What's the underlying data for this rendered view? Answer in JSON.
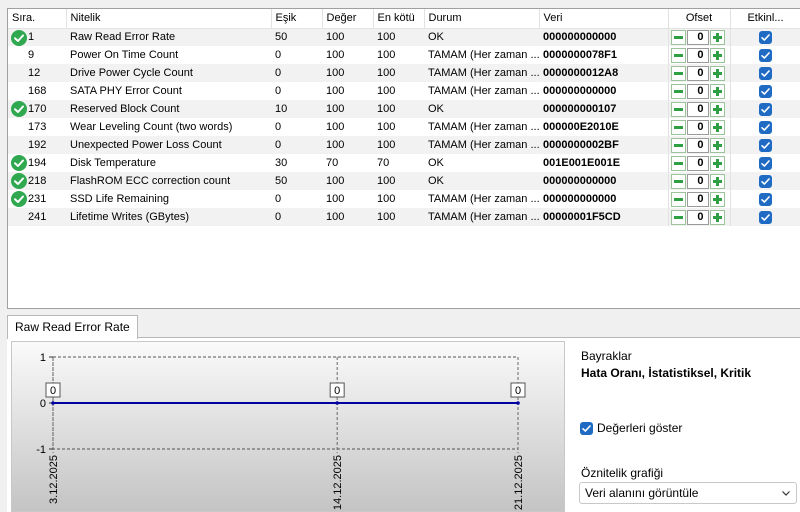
{
  "columns": {
    "idx": "Sıra.",
    "name": "Nitelik",
    "threshold": "Eşik",
    "value": "Değer",
    "worst": "En kötü",
    "status": "Durum",
    "data": "Veri",
    "offset": "Ofset",
    "enabled": "Etkinl..."
  },
  "rows": [
    {
      "idx": "1",
      "name": "Raw Read Error Rate",
      "threshold": "50",
      "value": "100",
      "worst": "100",
      "status": "OK",
      "data": "000000000000",
      "offset": "0",
      "enabled": true,
      "ok_icon": true
    },
    {
      "idx": "9",
      "name": "Power On Time Count",
      "threshold": "0",
      "value": "100",
      "worst": "100",
      "status": "TAMAM (Her zaman ...",
      "data": "0000000078F1",
      "offset": "0",
      "enabled": true,
      "ok_icon": false
    },
    {
      "idx": "12",
      "name": "Drive Power Cycle Count",
      "threshold": "0",
      "value": "100",
      "worst": "100",
      "status": "TAMAM (Her zaman ...",
      "data": "0000000012A8",
      "offset": "0",
      "enabled": true,
      "ok_icon": false
    },
    {
      "idx": "168",
      "name": "SATA PHY Error Count",
      "threshold": "0",
      "value": "100",
      "worst": "100",
      "status": "TAMAM (Her zaman ...",
      "data": "000000000000",
      "offset": "0",
      "enabled": true,
      "ok_icon": false
    },
    {
      "idx": "170",
      "name": "Reserved Block Count",
      "threshold": "10",
      "value": "100",
      "worst": "100",
      "status": "OK",
      "data": "000000000107",
      "offset": "0",
      "enabled": true,
      "ok_icon": true
    },
    {
      "idx": "173",
      "name": "Wear Leveling Count (two words)",
      "threshold": "0",
      "value": "100",
      "worst": "100",
      "status": "TAMAM (Her zaman ...",
      "data": "000000E2010E",
      "offset": "0",
      "enabled": true,
      "ok_icon": false
    },
    {
      "idx": "192",
      "name": "Unexpected Power Loss Count",
      "threshold": "0",
      "value": "100",
      "worst": "100",
      "status": "TAMAM (Her zaman ...",
      "data": "0000000002BF",
      "offset": "0",
      "enabled": true,
      "ok_icon": false
    },
    {
      "idx": "194",
      "name": "Disk Temperature",
      "threshold": "30",
      "value": "70",
      "worst": "70",
      "status": "OK",
      "data": "001E001E001E",
      "offset": "0",
      "enabled": true,
      "ok_icon": true
    },
    {
      "idx": "218",
      "name": "FlashROM ECC correction count",
      "threshold": "50",
      "value": "100",
      "worst": "100",
      "status": "OK",
      "data": "000000000000",
      "offset": "0",
      "enabled": true,
      "ok_icon": true
    },
    {
      "idx": "231",
      "name": "SSD Life Remaining",
      "threshold": "0",
      "value": "100",
      "worst": "100",
      "status": "TAMAM (Her zaman ...",
      "data": "000000000000",
      "offset": "0",
      "enabled": true,
      "ok_icon": true
    },
    {
      "idx": "241",
      "name": "Lifetime Writes (GBytes)",
      "threshold": "0",
      "value": "100",
      "worst": "100",
      "status": "TAMAM (Her zaman ...",
      "data": "00000001F5CD",
      "offset": "0",
      "enabled": true,
      "ok_icon": false
    }
  ],
  "tab": {
    "label": "Raw Read Error Rate"
  },
  "chart_data": {
    "type": "line",
    "x": [
      "3.12.2025",
      "14.12.2025",
      "21.12.2025"
    ],
    "series": [
      {
        "values": [
          0,
          0,
          0
        ]
      }
    ],
    "ylim": [
      -1,
      1
    ],
    "y_ticks": [
      "1",
      "0",
      "-1"
    ],
    "data_labels": [
      "0",
      "0",
      "0"
    ],
    "grid": true,
    "line_color": "#0000a0"
  },
  "side": {
    "flags_title": "Bayraklar",
    "flags_value": "Hata Oranı, İstatistiksel, Kritik",
    "show_values_label": "Değerleri göster",
    "show_values_checked": true,
    "attr_graph_label": "Öznitelik grafiği",
    "graph_select_value": "Veri alanını görüntüle"
  },
  "colors": {
    "ok_icon": "#2fa84f",
    "stepper_green": "#2ea043",
    "checkbox_blue": "#1f6bc4"
  },
  "icons": {
    "ok": "check-circle-icon",
    "minus": "minus-icon",
    "plus": "plus-icon",
    "checkbox": "checkmark-icon",
    "dropdown": "chevron-down-icon"
  }
}
